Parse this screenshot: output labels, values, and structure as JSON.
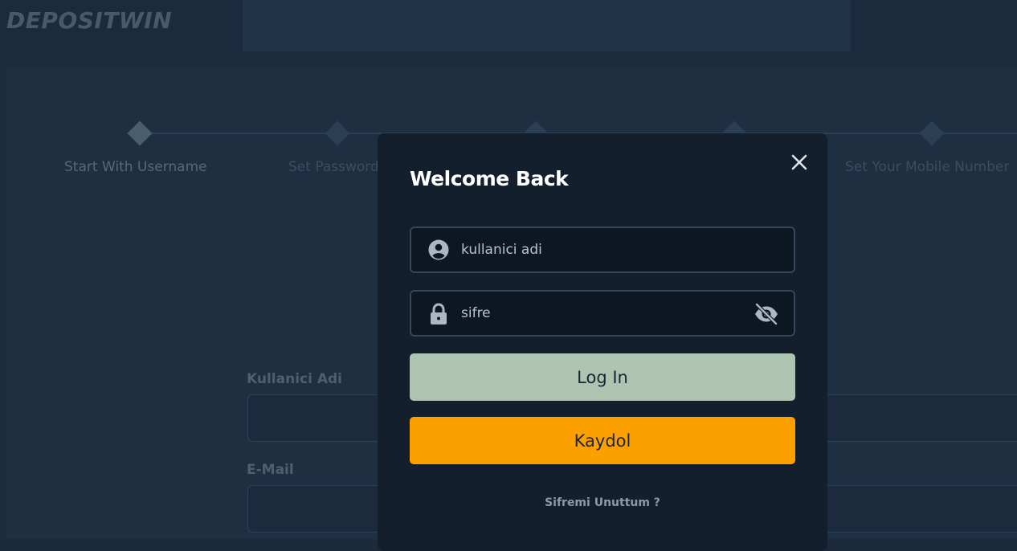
{
  "brand": {
    "logo_text": "DEPOSITWIN"
  },
  "steps": [
    {
      "label": "Start With Username",
      "active": true
    },
    {
      "label": "Set Password",
      "active": false
    },
    {
      "label": "",
      "active": false
    },
    {
      "label": "",
      "active": false
    },
    {
      "label": "Set Your Mobile Number",
      "active": false
    }
  ],
  "register_form": {
    "username_label": "Kullanici Adi",
    "email_label": "E-Mail"
  },
  "login_modal": {
    "title": "Welcome Back",
    "close_icon": "close-icon",
    "username": {
      "value": "",
      "placeholder": "kullanici adi",
      "icon": "user-icon"
    },
    "password": {
      "value": "",
      "placeholder": "sifre",
      "icon": "lock-icon",
      "toggle_icon": "eye-slash-icon"
    },
    "login_button": "Log In",
    "signup_button": "Kaydol",
    "forgot_link": "Sifremi Unuttum ?"
  },
  "colors": {
    "login_button": "#adc4b1",
    "signup_button": "#fca000",
    "modal_bg": "#141f2d",
    "page_bg": "#1b2b3d"
  }
}
